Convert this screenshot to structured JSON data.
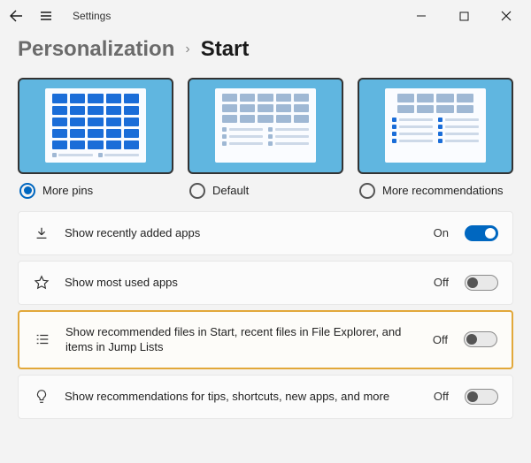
{
  "titlebar": {
    "title": "Settings"
  },
  "breadcrumb": {
    "parent": "Personalization",
    "current": "Start"
  },
  "layout": {
    "options": [
      {
        "label": "More pins",
        "selected": true
      },
      {
        "label": "Default",
        "selected": false
      },
      {
        "label": "More recommendations",
        "selected": false
      }
    ]
  },
  "settings": [
    {
      "icon": "download-icon",
      "label": "Show recently added apps",
      "state": "On",
      "on": true,
      "highlight": false
    },
    {
      "icon": "star-icon",
      "label": "Show most used apps",
      "state": "Off",
      "on": false,
      "highlight": false
    },
    {
      "icon": "list-icon",
      "label": "Show recommended files in Start, recent files in File Explorer, and items in Jump Lists",
      "state": "Off",
      "on": false,
      "highlight": true
    },
    {
      "icon": "lightbulb-icon",
      "label": "Show recommendations for tips, shortcuts, new apps, and more",
      "state": "Off",
      "on": false,
      "highlight": false
    }
  ]
}
